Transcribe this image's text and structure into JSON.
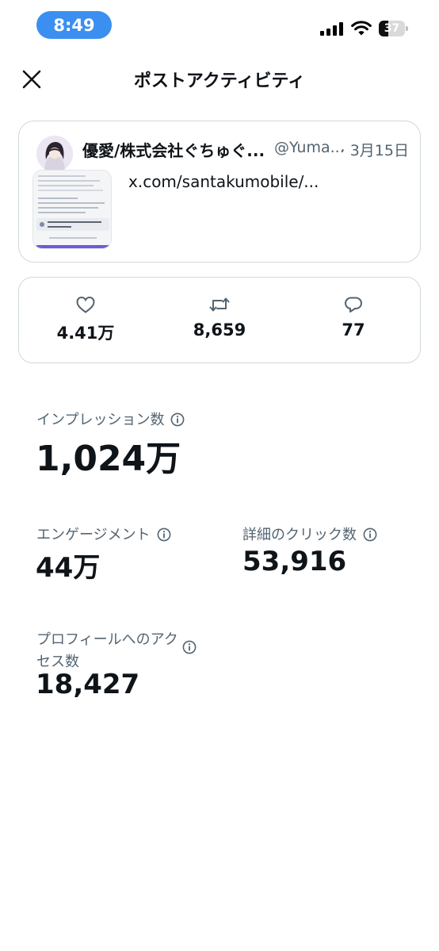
{
  "status_bar": {
    "time": "8:49",
    "battery_level": "37",
    "battery_fraction": 0.37
  },
  "header": {
    "title": "ポストアクティビティ",
    "close_icon": "close-icon"
  },
  "post": {
    "author_name": "優愛/株式会社ぐちゅぐ...",
    "author_handle": "@Yuma...",
    "date": "· 3月15日",
    "link_text": "x.com/santakumobile/..."
  },
  "engagement": {
    "likes": {
      "icon": "heart-icon",
      "value": "4.41万"
    },
    "reposts": {
      "icon": "repost-icon",
      "value": "8,659"
    },
    "replies": {
      "icon": "reply-icon",
      "value": "77"
    }
  },
  "metrics": {
    "impressions": {
      "label": "インプレッション数",
      "value": "1,024万"
    },
    "engagements": {
      "label": "エンゲージメント",
      "value": "44万"
    },
    "detail_clicks": {
      "label": "詳細のクリック数",
      "value": "53,916"
    },
    "profile_visits": {
      "label_line1": "プロフィールへのアク",
      "label_line2": "セス数",
      "value": "18,427"
    }
  },
  "colors": {
    "time_pill": "#3b8ff0",
    "text_primary": "#0f1419",
    "text_secondary": "#536471",
    "card_border": "#cfd9de"
  }
}
